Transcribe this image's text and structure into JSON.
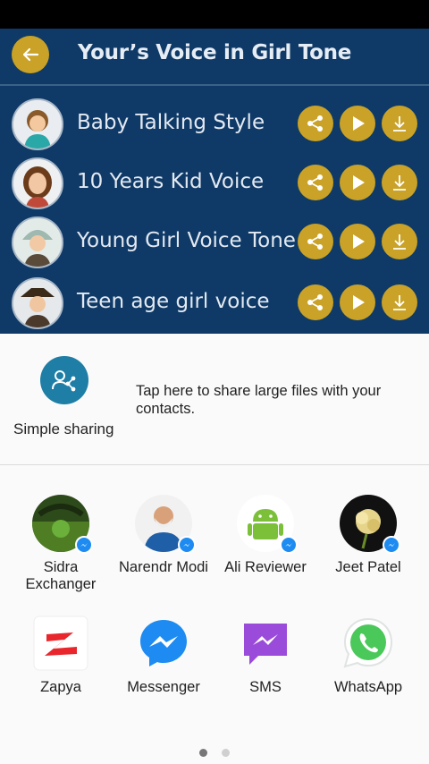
{
  "app": {
    "title": "Your’s Voice in Girl Tone",
    "accent_color": "#c9a227",
    "background_color": "#0f3a67",
    "voices": [
      {
        "label": "Baby Talking Style",
        "avatar": "baby-avatar"
      },
      {
        "label": "10 Years Kid Voice",
        "avatar": "kid-avatar"
      },
      {
        "label": "Young Girl Voice Tone",
        "avatar": "young-girl-avatar"
      },
      {
        "label": "Teen age girl voice",
        "avatar": "teen-girl-avatar"
      }
    ]
  },
  "share_sheet": {
    "simple_sharing": {
      "label": "Simple sharing",
      "description": "Tap here to share large files with your contacts.",
      "icon": "share-contacts-icon"
    },
    "direct_targets": [
      {
        "label": "Sidra Exchanger",
        "badge": "messenger-badge"
      },
      {
        "label": "Narendr Modi",
        "badge": "messenger-badge"
      },
      {
        "label": "Ali Reviewer",
        "badge": "messenger-badge"
      },
      {
        "label": "Jeet Patel",
        "badge": "messenger-badge"
      }
    ],
    "apps": [
      {
        "label": "Zapya",
        "icon": "zapya-icon"
      },
      {
        "label": "Messenger",
        "icon": "messenger-icon"
      },
      {
        "label": "SMS",
        "icon": "sms-icon"
      },
      {
        "label": "WhatsApp",
        "icon": "whatsapp-icon"
      }
    ],
    "pager": {
      "pages": 2,
      "current": 1
    }
  }
}
